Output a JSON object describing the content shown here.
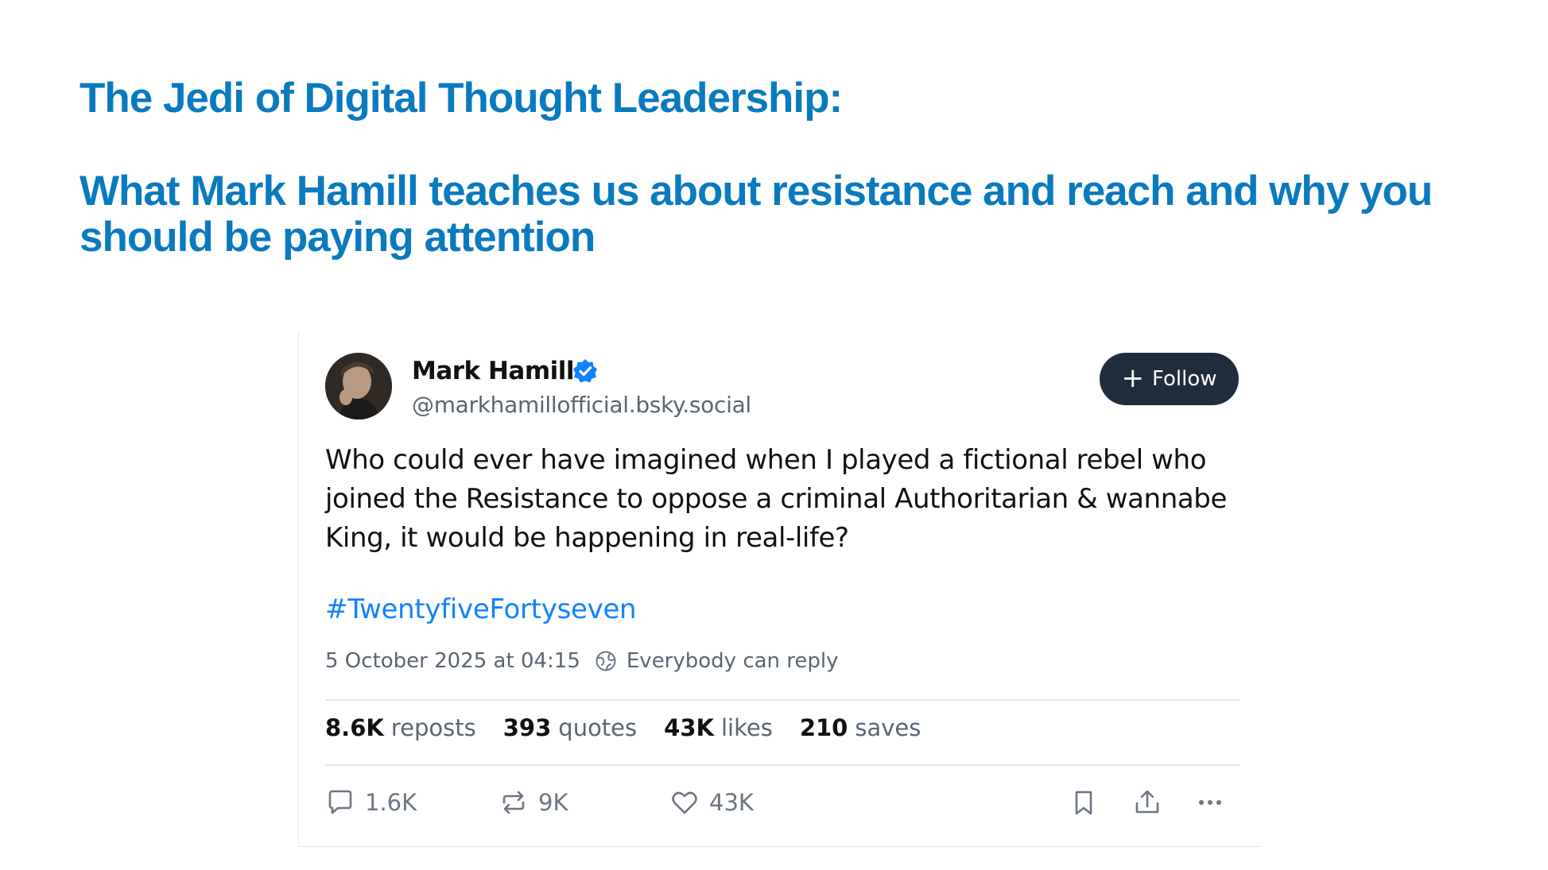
{
  "slide": {
    "title_line1": "The Jedi of Digital Thought Leadership:",
    "title_line2": "What Mark Hamill teaches us about resistance and reach and why you should be paying attention",
    "title_color": "#0a7abf"
  },
  "post": {
    "author": {
      "display_name": "Mark Hamill",
      "handle": "@markhamillofficial.bsky.social",
      "verified_icon": "verified-badge-icon"
    },
    "follow_button": {
      "label": "Follow",
      "icon": "plus-icon",
      "color": "#1f2d3d"
    },
    "text": "Who could ever have imagined when I played a fictional rebel who joined the Resistance to oppose a criminal Authoritarian & wannabe King, it would be happening in real-life?",
    "hashtag": "#TwentyfiveFortyseven",
    "hashtag_color": "#1083fe",
    "timestamp": "5 October 2025 at 04:15",
    "reply_setting": "Everybody can reply",
    "stats": [
      {
        "count": "8.6K",
        "label": "reposts"
      },
      {
        "count": "393",
        "label": "quotes"
      },
      {
        "count": "43K",
        "label": "likes"
      },
      {
        "count": "210",
        "label": "saves"
      }
    ],
    "actions": {
      "reply": {
        "icon": "reply-icon",
        "count": "1.6K"
      },
      "repost": {
        "icon": "repost-icon",
        "count": "9K"
      },
      "like": {
        "icon": "heart-icon",
        "count": "43K"
      },
      "bookmark": {
        "icon": "bookmark-icon"
      },
      "share": {
        "icon": "share-icon"
      },
      "more": {
        "icon": "more-icon"
      }
    }
  }
}
